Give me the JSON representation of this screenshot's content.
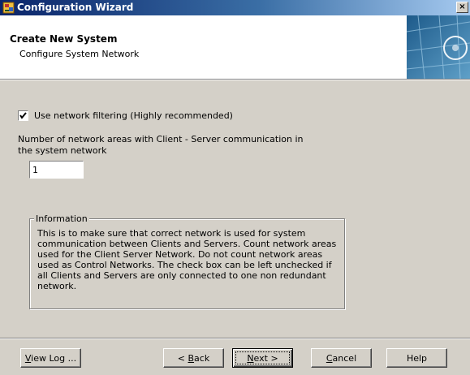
{
  "window": {
    "title": "Configuration Wizard",
    "close_glyph": "×",
    "icon": "wizard-app-icon"
  },
  "header": {
    "title": "Create New System",
    "subtitle": "Configure System Network"
  },
  "form": {
    "use_filtering": {
      "label": "Use network filtering (Highly recommended)",
      "checked": true
    },
    "network_count": {
      "label": "Number of network areas with Client - Server communication in the system network",
      "value": "1"
    }
  },
  "info": {
    "legend": "Information",
    "text": "This is to make sure that correct network is used for system communication between Clients and Servers. Count network areas used for the Client Server Network. Do not count network areas used as Control Networks. The check box can be left unchecked if all Clients and Servers are only connected to one non redundant network."
  },
  "buttons": {
    "view_log": {
      "mnemonic": "V",
      "rest": "iew Log ..."
    },
    "back": {
      "prefix": "< ",
      "mnemonic": "B",
      "rest": "ack"
    },
    "next": {
      "mnemonic": "N",
      "rest": "ext >"
    },
    "cancel": {
      "mnemonic": "C",
      "rest": "ancel"
    },
    "help": {
      "label": "Help"
    }
  },
  "colors": {
    "title_bar_start": "#0a246a",
    "title_bar_end": "#a6caf0",
    "dialog_face": "#d4d0c8",
    "header_bg": "#ffffff"
  }
}
